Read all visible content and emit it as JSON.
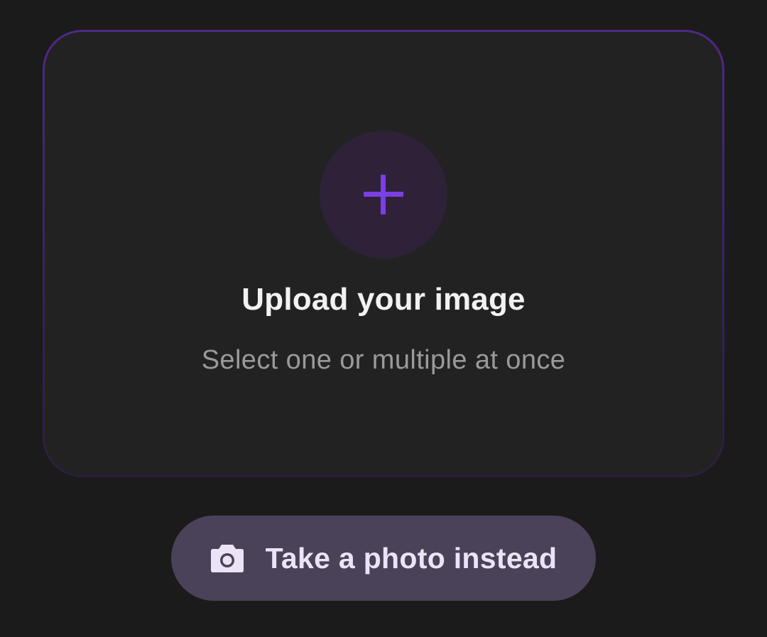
{
  "upload": {
    "title": "Upload your image",
    "subtitle": "Select one or multiple at once",
    "icon": "plus-icon"
  },
  "camera_button": {
    "label": "Take a photo instead",
    "icon": "camera-icon"
  },
  "colors": {
    "background": "#1b1b1b",
    "card": "#222222",
    "accent": "#7b3fe4",
    "icon_circle": "#2d2238",
    "button_bg": "#4a4259",
    "button_text": "#ece3f7"
  }
}
